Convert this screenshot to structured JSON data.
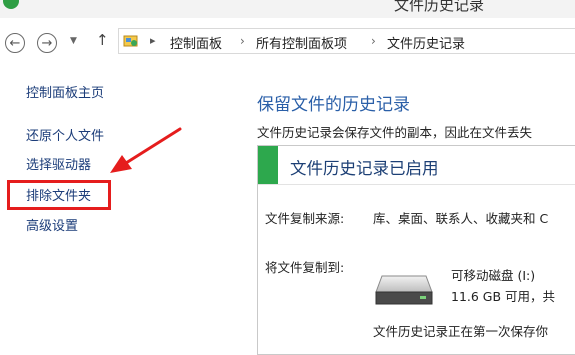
{
  "window": {
    "title": "文件历史记录"
  },
  "nav": {
    "back_icon": "back-arrow-icon",
    "forward_icon": "forward-arrow-icon",
    "recent_icon": "chevron-down-icon",
    "up_icon": "up-arrow-icon",
    "back_glyph": "←",
    "forward_glyph": "→",
    "recent_glyph": "▼",
    "up_glyph": "↑"
  },
  "breadcrumb": {
    "items": [
      "控制面板",
      "所有控制面板项",
      "文件历史记录"
    ],
    "separator": "›",
    "arrow": "▸"
  },
  "sidebar": {
    "items": [
      {
        "label": "控制面板主页"
      },
      {
        "label": "还原个人文件"
      },
      {
        "label": "选择驱动器"
      },
      {
        "label": "排除文件夹"
      },
      {
        "label": "高级设置"
      }
    ],
    "highlighted_index": 3,
    "highlight_color": "#e51d1d"
  },
  "main": {
    "heading": "保留文件的历史记录",
    "description": "文件历史记录会保存文件的副本，因此在文件丢失",
    "status": {
      "title": "文件历史记录已启用",
      "stripe_color": "#2da84d"
    },
    "source_label": "文件复制来源:",
    "source_value": "库、桌面、联系人、收藏夹和 C",
    "target_label": "将文件复制到:",
    "drive": {
      "icon": "removable-drive-icon",
      "name": "可移动磁盘 (I:)",
      "space": "11.6 GB 可用，共"
    },
    "backup_status": "文件历史记录正在第一次保存你"
  }
}
